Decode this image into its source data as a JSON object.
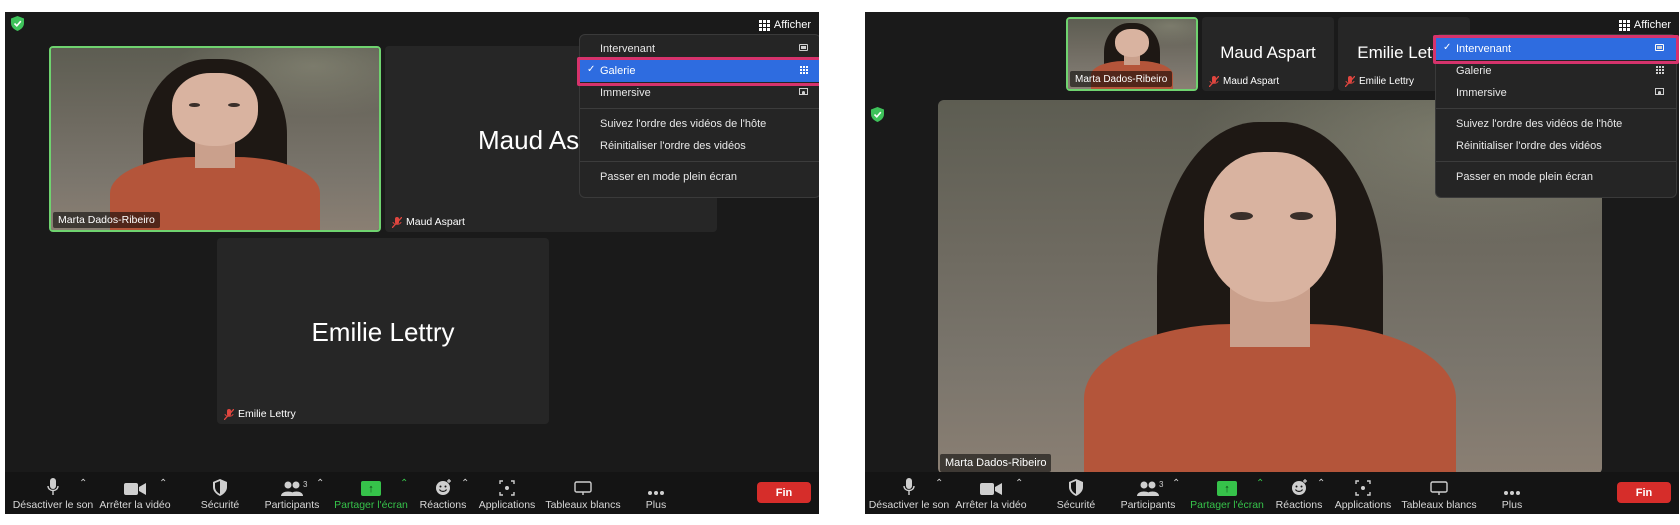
{
  "colors": {
    "window_bg": "#1a1a1a",
    "menu_selected": "#2e6ce0",
    "highlight_frame": "#d6336c",
    "active_speaker": "#6fd36f",
    "share_green": "#36c24a",
    "end_red": "#d62d2a"
  },
  "left": {
    "afficher_label": "Afficher",
    "menu": {
      "items": [
        {
          "label": "Intervenant",
          "icon": "speaker-view-icon",
          "checked": false
        },
        {
          "label": "Galerie",
          "icon": "gallery-grid-icon",
          "checked": true
        },
        {
          "label": "Immersive",
          "icon": "immersive-icon",
          "checked": false
        }
      ],
      "actions": [
        "Suivez l'ordre des vidéos de l'hôte",
        "Réinitialiser l'ordre des vidéos"
      ],
      "fullscreen": "Passer en mode plein écran"
    },
    "tiles": [
      {
        "name": "Marta Dados-Ribeiro",
        "video": true,
        "active": true
      },
      {
        "name": "Maud Aspart",
        "big_name": "Maud Aspart",
        "muted": true
      },
      {
        "name": "Emilie Lettry",
        "big_name": "Emilie Lettry",
        "muted": true
      }
    ]
  },
  "right": {
    "afficher_label": "Afficher",
    "menu": {
      "items": [
        {
          "label": "Intervenant",
          "icon": "speaker-view-icon",
          "checked": true
        },
        {
          "label": "Galerie",
          "icon": "gallery-grid-icon",
          "checked": false
        },
        {
          "label": "Immersive",
          "icon": "immersive-icon",
          "checked": false
        }
      ],
      "actions": [
        "Suivez l'ordre des vidéos de l'hôte",
        "Réinitialiser l'ordre des vidéos"
      ],
      "fullscreen": "Passer en mode plein écran"
    },
    "thumbs": [
      {
        "name": "Marta Dados-Ribeiro",
        "video": true,
        "active": true
      },
      {
        "name": "Maud Aspart",
        "big_name": "Maud Aspart",
        "muted": true
      },
      {
        "name": "Emilie Lettry",
        "big_name": "Emilie Lettry",
        "muted": true
      }
    ],
    "main_speaker": "Marta Dados-Ribeiro"
  },
  "toolbar": {
    "mute": "Désactiver le son",
    "video": "Arrêter la vidéo",
    "security": "Sécurité",
    "participants": "Participants",
    "participants_count": "3",
    "share": "Partager l'écran",
    "reactions": "Réactions",
    "apps": "Applications",
    "whiteboards": "Tableaux blancs",
    "more": "Plus",
    "end": "Fin"
  }
}
